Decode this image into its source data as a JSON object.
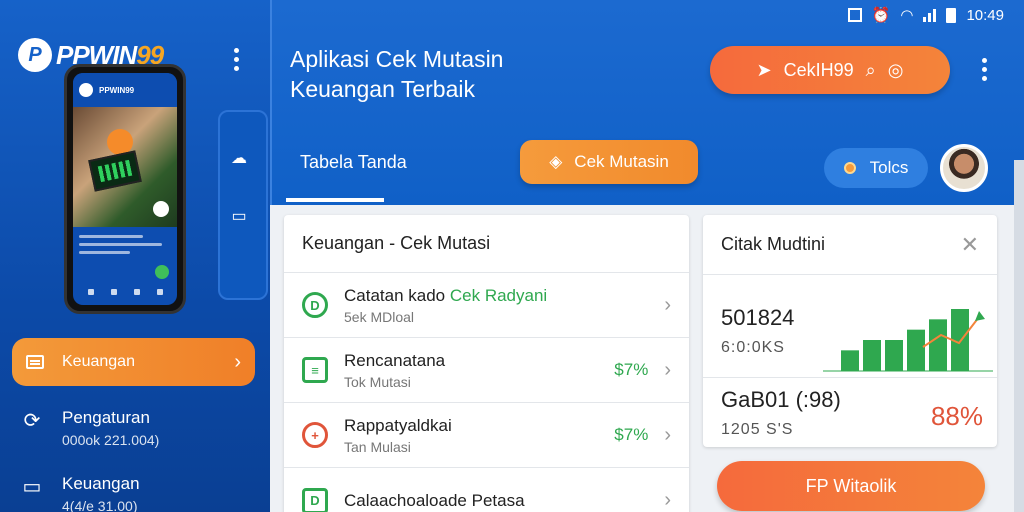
{
  "statusbar": {
    "time": "10:49"
  },
  "sidebar": {
    "brand": {
      "name_main": "PPWIN",
      "name_accent": "99"
    },
    "phone": {
      "header": "PPWIN99"
    },
    "menu_active": {
      "label": "Keuangan"
    },
    "items": [
      {
        "title": "Pengaturan",
        "sub": "000ok 221.004)"
      },
      {
        "title": "Keuangan",
        "sub": "4(4/e 31.00)"
      }
    ]
  },
  "header": {
    "title_line1": "Aplikasi Cek Mutasin",
    "title_line2": "Keuangan Terbaik",
    "search_button": "CekIH99",
    "tab_active": "Tabela Tanda",
    "cek_button": "Cek Mutasin",
    "tools_pill": "Tolcs"
  },
  "list_card": {
    "title": "Keuangan - Cek Mutasi",
    "rows": [
      {
        "title_plain": "Catatan kado",
        "title_accent": " Cek Radyani",
        "sub": "5ek MDloal",
        "pct": "",
        "icon": "D"
      },
      {
        "title_plain": "Rencanatana",
        "title_accent": "",
        "sub": "Tok Mutasi",
        "pct": "$7%",
        "icon": "≡"
      },
      {
        "title_plain": "Rappatyaldkai",
        "title_accent": "",
        "sub": "Tan Mulasi",
        "pct": "$7%",
        "icon": "+"
      },
      {
        "title_plain": "Calaachoaloade Petasa",
        "title_accent": "",
        "sub": "",
        "pct": "",
        "icon": "D"
      }
    ]
  },
  "stat_card": {
    "title": "Citak Mudtini",
    "value_a": "501824",
    "sub_a": "6:0:0KS",
    "value_b": "GaB01 (:98)",
    "sub_b": "1205 S'S",
    "pct": "88%"
  },
  "wa_button": "FP Witaolik",
  "chart_data": {
    "type": "bar",
    "values": [
      2,
      3,
      3,
      4,
      5,
      6
    ],
    "ylim": [
      0,
      6
    ]
  },
  "colors": {
    "primary": "#1662c9",
    "accent": "#f4843a",
    "success": "#2fa84f",
    "danger": "#e0553a"
  }
}
